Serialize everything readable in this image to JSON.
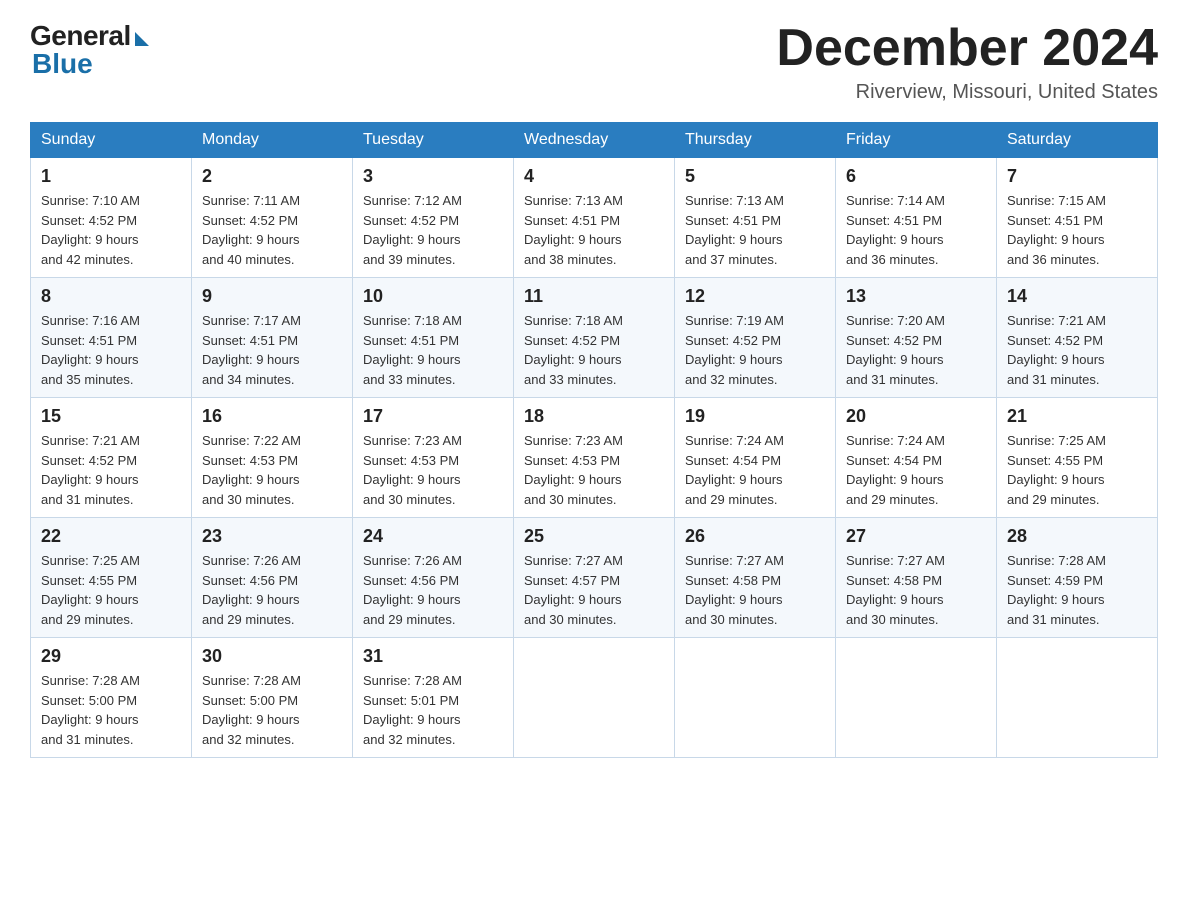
{
  "header": {
    "logo_general": "General",
    "logo_blue": "Blue",
    "month_title": "December 2024",
    "subtitle": "Riverview, Missouri, United States"
  },
  "weekdays": [
    "Sunday",
    "Monday",
    "Tuesday",
    "Wednesday",
    "Thursday",
    "Friday",
    "Saturday"
  ],
  "weeks": [
    [
      {
        "day": "1",
        "sunrise": "7:10 AM",
        "sunset": "4:52 PM",
        "daylight": "9 hours and 42 minutes."
      },
      {
        "day": "2",
        "sunrise": "7:11 AM",
        "sunset": "4:52 PM",
        "daylight": "9 hours and 40 minutes."
      },
      {
        "day": "3",
        "sunrise": "7:12 AM",
        "sunset": "4:52 PM",
        "daylight": "9 hours and 39 minutes."
      },
      {
        "day": "4",
        "sunrise": "7:13 AM",
        "sunset": "4:51 PM",
        "daylight": "9 hours and 38 minutes."
      },
      {
        "day": "5",
        "sunrise": "7:13 AM",
        "sunset": "4:51 PM",
        "daylight": "9 hours and 37 minutes."
      },
      {
        "day": "6",
        "sunrise": "7:14 AM",
        "sunset": "4:51 PM",
        "daylight": "9 hours and 36 minutes."
      },
      {
        "day": "7",
        "sunrise": "7:15 AM",
        "sunset": "4:51 PM",
        "daylight": "9 hours and 36 minutes."
      }
    ],
    [
      {
        "day": "8",
        "sunrise": "7:16 AM",
        "sunset": "4:51 PM",
        "daylight": "9 hours and 35 minutes."
      },
      {
        "day": "9",
        "sunrise": "7:17 AM",
        "sunset": "4:51 PM",
        "daylight": "9 hours and 34 minutes."
      },
      {
        "day": "10",
        "sunrise": "7:18 AM",
        "sunset": "4:51 PM",
        "daylight": "9 hours and 33 minutes."
      },
      {
        "day": "11",
        "sunrise": "7:18 AM",
        "sunset": "4:52 PM",
        "daylight": "9 hours and 33 minutes."
      },
      {
        "day": "12",
        "sunrise": "7:19 AM",
        "sunset": "4:52 PM",
        "daylight": "9 hours and 32 minutes."
      },
      {
        "day": "13",
        "sunrise": "7:20 AM",
        "sunset": "4:52 PM",
        "daylight": "9 hours and 31 minutes."
      },
      {
        "day": "14",
        "sunrise": "7:21 AM",
        "sunset": "4:52 PM",
        "daylight": "9 hours and 31 minutes."
      }
    ],
    [
      {
        "day": "15",
        "sunrise": "7:21 AM",
        "sunset": "4:52 PM",
        "daylight": "9 hours and 31 minutes."
      },
      {
        "day": "16",
        "sunrise": "7:22 AM",
        "sunset": "4:53 PM",
        "daylight": "9 hours and 30 minutes."
      },
      {
        "day": "17",
        "sunrise": "7:23 AM",
        "sunset": "4:53 PM",
        "daylight": "9 hours and 30 minutes."
      },
      {
        "day": "18",
        "sunrise": "7:23 AM",
        "sunset": "4:53 PM",
        "daylight": "9 hours and 30 minutes."
      },
      {
        "day": "19",
        "sunrise": "7:24 AM",
        "sunset": "4:54 PM",
        "daylight": "9 hours and 29 minutes."
      },
      {
        "day": "20",
        "sunrise": "7:24 AM",
        "sunset": "4:54 PM",
        "daylight": "9 hours and 29 minutes."
      },
      {
        "day": "21",
        "sunrise": "7:25 AM",
        "sunset": "4:55 PM",
        "daylight": "9 hours and 29 minutes."
      }
    ],
    [
      {
        "day": "22",
        "sunrise": "7:25 AM",
        "sunset": "4:55 PM",
        "daylight": "9 hours and 29 minutes."
      },
      {
        "day": "23",
        "sunrise": "7:26 AM",
        "sunset": "4:56 PM",
        "daylight": "9 hours and 29 minutes."
      },
      {
        "day": "24",
        "sunrise": "7:26 AM",
        "sunset": "4:56 PM",
        "daylight": "9 hours and 29 minutes."
      },
      {
        "day": "25",
        "sunrise": "7:27 AM",
        "sunset": "4:57 PM",
        "daylight": "9 hours and 30 minutes."
      },
      {
        "day": "26",
        "sunrise": "7:27 AM",
        "sunset": "4:58 PM",
        "daylight": "9 hours and 30 minutes."
      },
      {
        "day": "27",
        "sunrise": "7:27 AM",
        "sunset": "4:58 PM",
        "daylight": "9 hours and 30 minutes."
      },
      {
        "day": "28",
        "sunrise": "7:28 AM",
        "sunset": "4:59 PM",
        "daylight": "9 hours and 31 minutes."
      }
    ],
    [
      {
        "day": "29",
        "sunrise": "7:28 AM",
        "sunset": "5:00 PM",
        "daylight": "9 hours and 31 minutes."
      },
      {
        "day": "30",
        "sunrise": "7:28 AM",
        "sunset": "5:00 PM",
        "daylight": "9 hours and 32 minutes."
      },
      {
        "day": "31",
        "sunrise": "7:28 AM",
        "sunset": "5:01 PM",
        "daylight": "9 hours and 32 minutes."
      },
      null,
      null,
      null,
      null
    ]
  ],
  "labels": {
    "sunrise": "Sunrise:",
    "sunset": "Sunset:",
    "daylight": "Daylight:"
  }
}
